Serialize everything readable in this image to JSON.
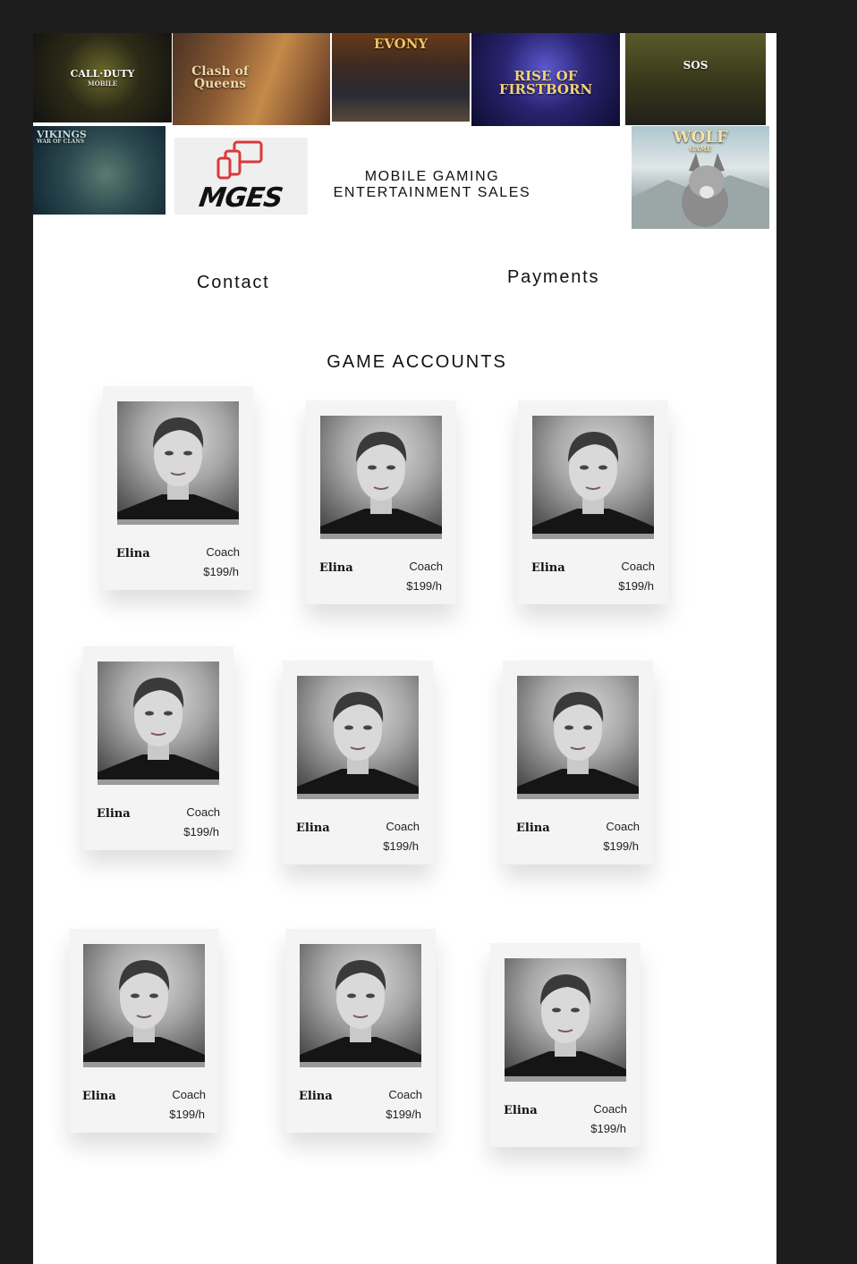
{
  "banners": [
    {
      "id": "cod",
      "text": "CALL·DUTY",
      "sub": "MOBILE",
      "color": "#f5d63a"
    },
    {
      "id": "coq",
      "text": "Clash of Queens",
      "color": "#f0d9a8"
    },
    {
      "id": "evony",
      "text": "EVONY",
      "color": "#f2c35a"
    },
    {
      "id": "rise",
      "text": "RISE OF FIRSTBORN",
      "color": "#f3d27a"
    },
    {
      "id": "sos",
      "text": "SOS",
      "color": "#ffffff"
    },
    {
      "id": "vikings",
      "text": "VIKINGS",
      "sub": "WAR OF CLANS",
      "color": "#c8d8d8"
    },
    {
      "id": "wolf",
      "text": "WOLF",
      "sub": "GAME",
      "color": "#f3e3a0"
    }
  ],
  "logo": {
    "text": "MGES",
    "icon_color": "#d93a3a"
  },
  "site_title": {
    "line1": "MOBILE GAMING",
    "line2": "ENTERTAINMENT SALES"
  },
  "nav": {
    "contact": "Contact",
    "payments": "Payments"
  },
  "section_title": "GAME ACCOUNTS",
  "cards": [
    {
      "name": "Elina",
      "role": "Coach",
      "price": "$199/h"
    },
    {
      "name": "Elina",
      "role": "Coach",
      "price": "$199/h"
    },
    {
      "name": "Elina",
      "role": "Coach",
      "price": "$199/h"
    },
    {
      "name": "Elina",
      "role": "Coach",
      "price": "$199/h"
    },
    {
      "name": "Elina",
      "role": "Coach",
      "price": "$199/h"
    },
    {
      "name": "Elina",
      "role": "Coach",
      "price": "$199/h"
    },
    {
      "name": "Elina",
      "role": "Coach",
      "price": "$199/h"
    },
    {
      "name": "Elina",
      "role": "Coach",
      "price": "$199/h"
    },
    {
      "name": "Elina",
      "role": "Coach",
      "price": "$199/h"
    }
  ]
}
